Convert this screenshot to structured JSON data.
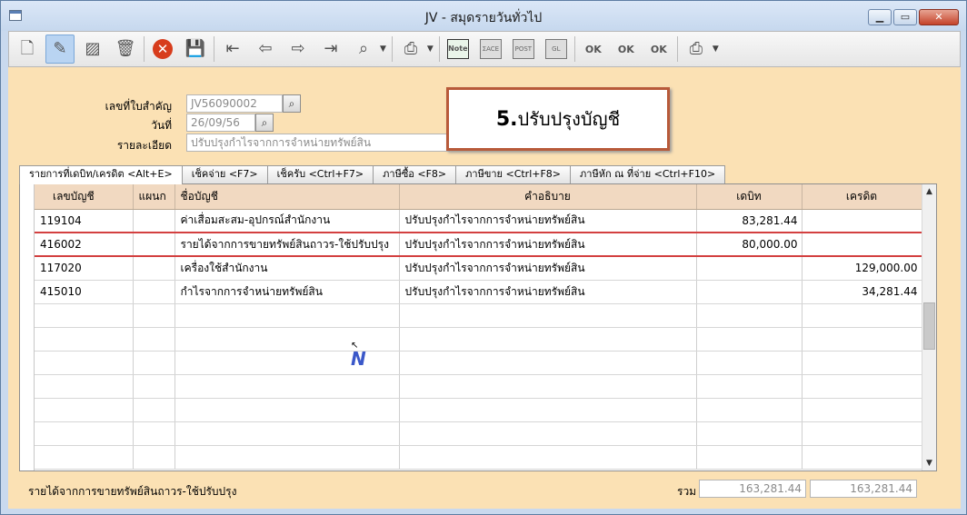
{
  "window": {
    "title": "JV - สมุดรายวันทั่วไป",
    "minimize": "▁",
    "maximize": "▭",
    "close": "✕"
  },
  "form": {
    "doc_no_label": "เลขที่ใบสำคัญ",
    "doc_no_value": "JV56090002",
    "date_label": "วันที่",
    "date_value": "26/09/56",
    "detail_label": "รายละเอียด",
    "detail_value": "ปรับปรุงกำไรจากการจำหน่ายทรัพย์สิน"
  },
  "note": {
    "number": "5.",
    "text": "ปรับปรุงบัญชี"
  },
  "tabs": [
    {
      "label": "รายการที่เดบิท/เครดิต <Alt+E>"
    },
    {
      "label": "เช็คจ่าย <F7>"
    },
    {
      "label": "เช็ครับ <Ctrl+F7>"
    },
    {
      "label": "ภาษีซื้อ <F8>"
    },
    {
      "label": "ภาษีขาย <Ctrl+F8>"
    },
    {
      "label": "ภาษีหัก ณ ที่จ่าย <Ctrl+F10>"
    }
  ],
  "table": {
    "headers": {
      "account_no": "เลขบัญชี",
      "dept": "แผนก",
      "account_name": "ชื่อบัญชี",
      "description": "คำอธิบาย",
      "debit": "เดบิท",
      "credit": "เครดิต"
    },
    "rows": [
      {
        "account_no": "119104",
        "dept": "",
        "account_name": "ค่าเสื่อมสะสม-อุปกรณ์สำนักงาน",
        "description": "ปรับปรุงกำไรจากการจำหน่ายทรัพย์สิน",
        "debit": "83,281.44",
        "credit": ""
      },
      {
        "account_no": "416002",
        "dept": "",
        "account_name": "รายได้จากการขายทรัพย์สินถาวร-ใช้ปรับปรุง",
        "description": "ปรับปรุงกำไรจากการจำหน่ายทรัพย์สิน",
        "debit": "80,000.00",
        "credit": ""
      },
      {
        "account_no": "117020",
        "dept": "",
        "account_name": "เครื่องใช้สำนักงาน",
        "description": "ปรับปรุงกำไรจากการจำหน่ายทรัพย์สิน",
        "debit": "",
        "credit": "129,000.00"
      },
      {
        "account_no": "415010",
        "dept": "",
        "account_name": "กำไรจากการจำหน่ายทรัพย์สิน",
        "description": "ปรับปรุงกำไรจากการจำหน่ายทรัพย์สิน",
        "debit": "",
        "credit": "34,281.44"
      }
    ]
  },
  "footer": {
    "selected_account": "รายได้จากการขายทรัพย์สินถาวร-ใช้ปรับปรุง",
    "total_label": "รวม",
    "total_debit": "163,281.44",
    "total_credit": "163,281.44"
  },
  "toolbar_icons": [
    "new-icon",
    "edit-icon",
    "copy-icon",
    "delete-icon",
    "cancel-icon",
    "save-icon",
    "first-icon",
    "prev-icon",
    "next-icon",
    "last-icon",
    "find-icon",
    "print-icon",
    "note-icon",
    "trace-icon",
    "post-icon",
    "gl-icon",
    "ok-stamp-icon",
    "ok-edit-icon",
    "ok-doc-icon",
    "print-options-icon"
  ],
  "note_icon_text": "Note",
  "toolbar_grey_texts": [
    "ΣACE",
    "POST",
    "GL"
  ],
  "stamp_text": "OK",
  "logo_text": "N"
}
